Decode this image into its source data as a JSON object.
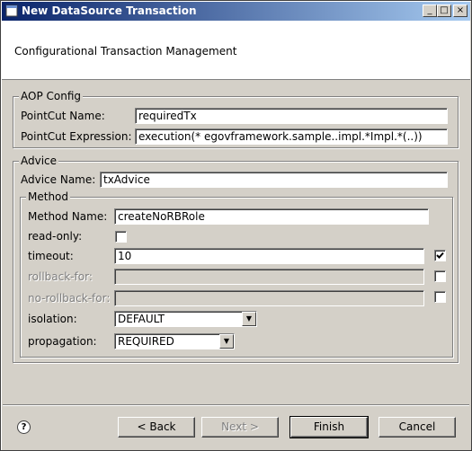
{
  "window": {
    "title": "New DataSource Transaction",
    "controls": {
      "minimize": "_",
      "maximize": "□",
      "close": "×"
    }
  },
  "header": {
    "text": "Configurational Transaction Management"
  },
  "aop_config": {
    "label": "AOP Config",
    "pointcut_name_label": "PointCut Name:",
    "pointcut_name_value": "requiredTx",
    "pointcut_expression_label": "PointCut Expression:",
    "pointcut_expression_value": "execution(* egovframework.sample..impl.*Impl.*(..))"
  },
  "advice": {
    "label": "Advice",
    "advice_name_label": "Advice Name:",
    "advice_name_value": "txAdvice",
    "method": {
      "label": "Method",
      "method_name_label": "Method Name:",
      "method_name_value": "createNoRBRole",
      "read_only_label": "read-only:",
      "read_only_checked": false,
      "timeout_label": "timeout:",
      "timeout_value": "10",
      "timeout_checked": true,
      "rollback_for_label": "rollback-for:",
      "rollback_for_value": "",
      "rollback_for_checked": false,
      "no_rollback_for_label": "no-rollback-for:",
      "no_rollback_for_value": "",
      "no_rollback_for_checked": false,
      "isolation_label": "isolation:",
      "isolation_value": "DEFAULT",
      "propagation_label": "propagation:",
      "propagation_value": "REQUIRED"
    }
  },
  "buttons": {
    "help_icon": "?",
    "back": "< Back",
    "next": "Next >",
    "finish": "Finish",
    "cancel": "Cancel"
  }
}
